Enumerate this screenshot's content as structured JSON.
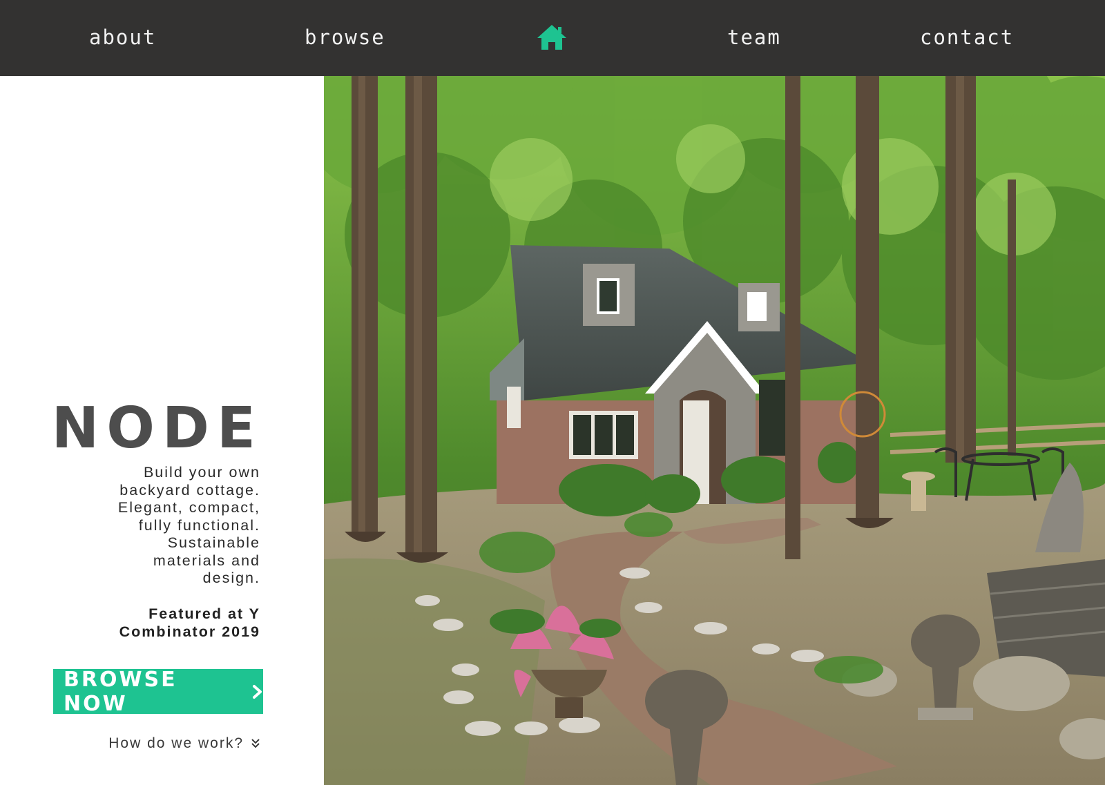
{
  "nav": {
    "about": "about",
    "browse": "browse",
    "team": "team",
    "contact": "contact",
    "home_icon": "home-icon"
  },
  "hero": {
    "brand": "NODE",
    "tagline_lines": [
      "Build your own",
      "backyard cottage.",
      "Elegant, compact,",
      "fully functional.",
      "Sustainable",
      "materials and",
      "design."
    ],
    "featured_lines": [
      "Featured at Y",
      "Combinator 2019"
    ],
    "cta_label": "BROWSE NOW",
    "how_link": "How do we work?"
  },
  "colors": {
    "nav_bg": "#333231",
    "accent": "#1ec391",
    "brand_text": "#4d4d4d"
  }
}
